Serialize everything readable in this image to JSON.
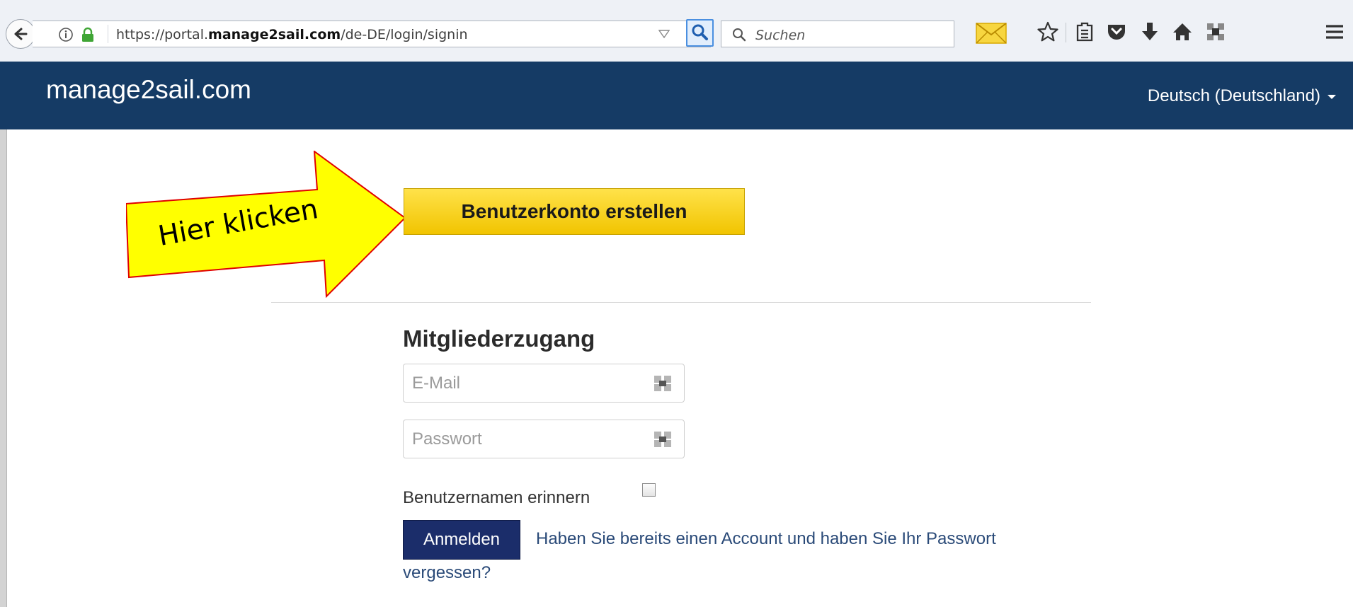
{
  "browser": {
    "url_prefix": "https://portal.",
    "url_domain": "manage2sail.com",
    "url_path": "/de-DE/login/signin",
    "search_placeholder": "Suchen"
  },
  "navbar": {
    "brand": "manage2sail.com",
    "language": "Deutsch (Deutschland)"
  },
  "callout": {
    "text": "Hier klicken",
    "fill_color": "#ffff00",
    "border_color": "#e00000"
  },
  "signup": {
    "button_label": "Benutzerkonto erstellen"
  },
  "login": {
    "title": "Mitgliederzugang",
    "email_placeholder": "E-Mail",
    "password_placeholder": "Passwort",
    "remember_label": "Benutzernamen erinnern",
    "remember_checked": false,
    "submit_label": "Anmelden",
    "forgot_text": "Haben Sie bereits einen Account und haben Sie Ihr Passwort vergessen?"
  },
  "colors": {
    "navbar": "#153b65",
    "cta": "#f5cb10",
    "submit": "#1b2d6a"
  }
}
